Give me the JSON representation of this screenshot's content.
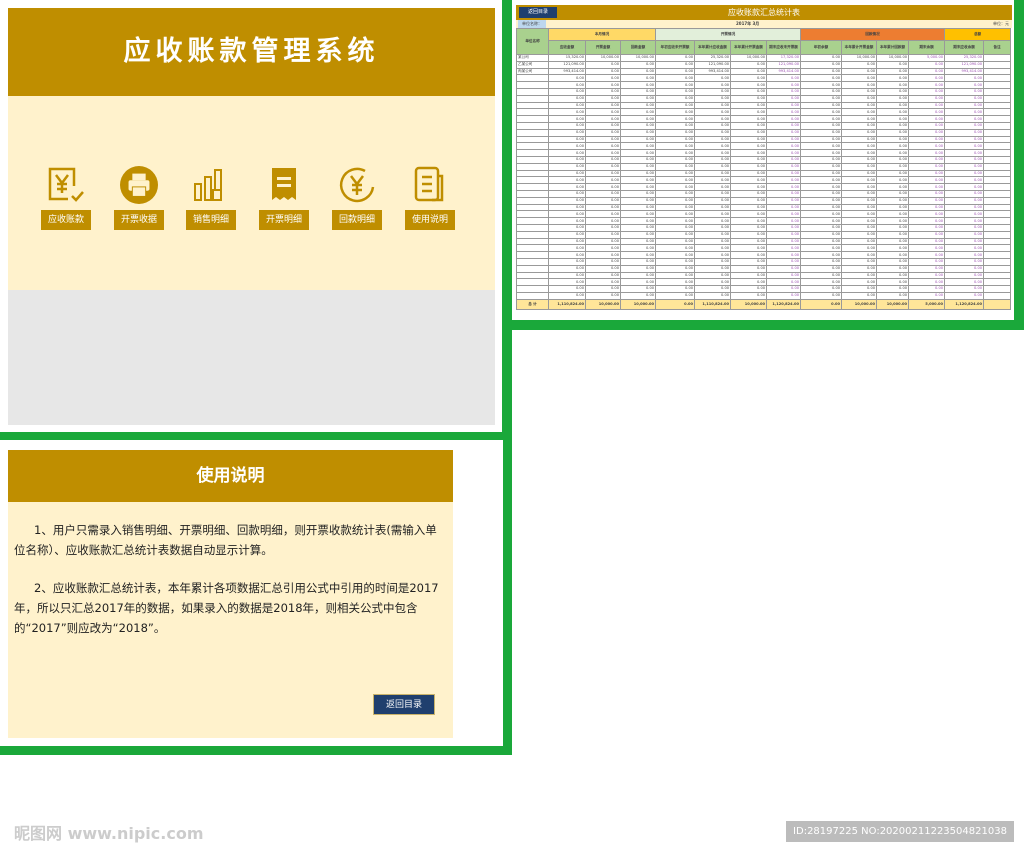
{
  "main_menu": {
    "title": "应收账款管理系统",
    "tiles": [
      {
        "label": "应收账款",
        "icon": "yen-receipt-icon"
      },
      {
        "label": "开票收据",
        "icon": "printer-icon"
      },
      {
        "label": "销售明细",
        "icon": "bar-chart-icon"
      },
      {
        "label": "开票明细",
        "icon": "invoice-icon"
      },
      {
        "label": "回款明细",
        "icon": "yen-circle-icon"
      },
      {
        "label": "使用说明",
        "icon": "document-icon"
      }
    ]
  },
  "sheet": {
    "back_label": "返回目录",
    "title": "应收账款汇总统计表",
    "company_label": "单位名称：",
    "period": "2017年 3月",
    "unit": "单位：元",
    "groups": [
      {
        "label": "单位名称",
        "color": "#a9d18e"
      },
      {
        "label": "本月情况",
        "color": "#ffd966"
      },
      {
        "label": "开票情况",
        "color": "#e2efda"
      },
      {
        "label": "回款情况",
        "color": "#ed7d31"
      },
      {
        "label": "总额",
        "color": "#ffc000"
      }
    ],
    "columns": [
      "应收金额",
      "开票金额",
      "回款金额",
      "年初应收未开票额",
      "本年累计应收金额",
      "本年累计开票金额",
      "期末应收未开票额",
      "年初余额",
      "本年累计开票金额",
      "本年累计回款额",
      "期末余额",
      "期末应收余额",
      "备注"
    ],
    "rows": [
      [
        "某公司",
        "15,320.00",
        "10,000.00",
        "10,000.00",
        "0.00",
        "25,320.00",
        "10,000.00",
        "17,320.00",
        "0.00",
        "10,000.00",
        "10,000.00",
        "5,000.00",
        "25,320.00",
        ""
      ],
      [
        "乙某公司",
        "121,090.00",
        "0.00",
        "0.00",
        "0.00",
        "121,090.00",
        "0.00",
        "121,090.00",
        "0.00",
        "0.00",
        "0.00",
        "0.00",
        "121,090.00",
        ""
      ],
      [
        "丙某公司",
        "993,414.00",
        "0.00",
        "0.00",
        "0.00",
        "993,414.00",
        "0.00",
        "993,414.00",
        "0.00",
        "0.00",
        "0.00",
        "0.00",
        "993,414.00",
        ""
      ]
    ],
    "empty_row": [
      "",
      "0.00",
      "0.00",
      "0.00",
      "0.00",
      "0.00",
      "0.00",
      "0.00",
      "0.00",
      "0.00",
      "0.00",
      "0.00",
      "0.00",
      ""
    ],
    "total": [
      "总 计",
      "1,110,824.00",
      "10,000.00",
      "10,000.00",
      "0.00",
      "1,110,824.00",
      "10,000.00",
      "1,120,824.00",
      "0.00",
      "10,000.00",
      "10,000.00",
      "5,000.00",
      "1,120,824.00",
      ""
    ]
  },
  "help": {
    "title": "使用说明",
    "paragraphs": [
      "1、用户只需录入销售明细、开票明细、回款明细，则开票收款统计表(需输入单位名称）、应收账款汇总统计表数据自动显示计算。",
      "2、应收账款汇总统计表，本年累计各项数据汇总引用公式中引用的时间是2017年，所以只汇总2017年的数据，如果录入的数据是2018年，则相关公式中包含的“2017”则应改为“2018”。"
    ],
    "back_label": "返回目录"
  },
  "watermark": {
    "logo_text": "昵图网 www.nipic.com",
    "id_text": "ID:28197225 NO:20200211223504821038"
  },
  "colors": {
    "gold": "#bf8e00",
    "cream": "#fff2cc",
    "frame_green": "#1aa83a",
    "navy": "#1f3f6e"
  }
}
